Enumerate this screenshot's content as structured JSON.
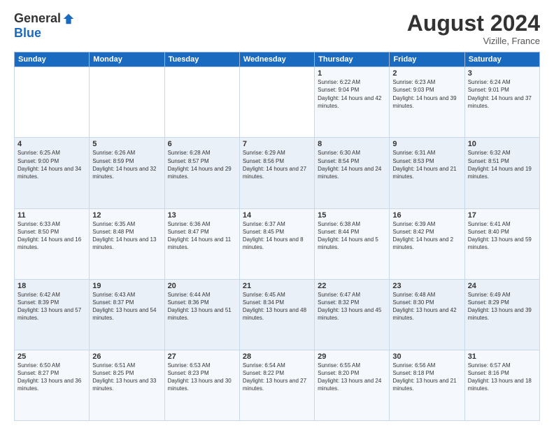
{
  "header": {
    "logo_general": "General",
    "logo_blue": "Blue",
    "month_title": "August 2024",
    "location": "Vizille, France"
  },
  "days_of_week": [
    "Sunday",
    "Monday",
    "Tuesday",
    "Wednesday",
    "Thursday",
    "Friday",
    "Saturday"
  ],
  "weeks": [
    [
      {
        "day": "",
        "sunrise": "",
        "sunset": "",
        "daylight": ""
      },
      {
        "day": "",
        "sunrise": "",
        "sunset": "",
        "daylight": ""
      },
      {
        "day": "",
        "sunrise": "",
        "sunset": "",
        "daylight": ""
      },
      {
        "day": "",
        "sunrise": "",
        "sunset": "",
        "daylight": ""
      },
      {
        "day": "1",
        "sunrise": "Sunrise: 6:22 AM",
        "sunset": "Sunset: 9:04 PM",
        "daylight": "Daylight: 14 hours and 42 minutes."
      },
      {
        "day": "2",
        "sunrise": "Sunrise: 6:23 AM",
        "sunset": "Sunset: 9:03 PM",
        "daylight": "Daylight: 14 hours and 39 minutes."
      },
      {
        "day": "3",
        "sunrise": "Sunrise: 6:24 AM",
        "sunset": "Sunset: 9:01 PM",
        "daylight": "Daylight: 14 hours and 37 minutes."
      }
    ],
    [
      {
        "day": "4",
        "sunrise": "Sunrise: 6:25 AM",
        "sunset": "Sunset: 9:00 PM",
        "daylight": "Daylight: 14 hours and 34 minutes."
      },
      {
        "day": "5",
        "sunrise": "Sunrise: 6:26 AM",
        "sunset": "Sunset: 8:59 PM",
        "daylight": "Daylight: 14 hours and 32 minutes."
      },
      {
        "day": "6",
        "sunrise": "Sunrise: 6:28 AM",
        "sunset": "Sunset: 8:57 PM",
        "daylight": "Daylight: 14 hours and 29 minutes."
      },
      {
        "day": "7",
        "sunrise": "Sunrise: 6:29 AM",
        "sunset": "Sunset: 8:56 PM",
        "daylight": "Daylight: 14 hours and 27 minutes."
      },
      {
        "day": "8",
        "sunrise": "Sunrise: 6:30 AM",
        "sunset": "Sunset: 8:54 PM",
        "daylight": "Daylight: 14 hours and 24 minutes."
      },
      {
        "day": "9",
        "sunrise": "Sunrise: 6:31 AM",
        "sunset": "Sunset: 8:53 PM",
        "daylight": "Daylight: 14 hours and 21 minutes."
      },
      {
        "day": "10",
        "sunrise": "Sunrise: 6:32 AM",
        "sunset": "Sunset: 8:51 PM",
        "daylight": "Daylight: 14 hours and 19 minutes."
      }
    ],
    [
      {
        "day": "11",
        "sunrise": "Sunrise: 6:33 AM",
        "sunset": "Sunset: 8:50 PM",
        "daylight": "Daylight: 14 hours and 16 minutes."
      },
      {
        "day": "12",
        "sunrise": "Sunrise: 6:35 AM",
        "sunset": "Sunset: 8:48 PM",
        "daylight": "Daylight: 14 hours and 13 minutes."
      },
      {
        "day": "13",
        "sunrise": "Sunrise: 6:36 AM",
        "sunset": "Sunset: 8:47 PM",
        "daylight": "Daylight: 14 hours and 11 minutes."
      },
      {
        "day": "14",
        "sunrise": "Sunrise: 6:37 AM",
        "sunset": "Sunset: 8:45 PM",
        "daylight": "Daylight: 14 hours and 8 minutes."
      },
      {
        "day": "15",
        "sunrise": "Sunrise: 6:38 AM",
        "sunset": "Sunset: 8:44 PM",
        "daylight": "Daylight: 14 hours and 5 minutes."
      },
      {
        "day": "16",
        "sunrise": "Sunrise: 6:39 AM",
        "sunset": "Sunset: 8:42 PM",
        "daylight": "Daylight: 14 hours and 2 minutes."
      },
      {
        "day": "17",
        "sunrise": "Sunrise: 6:41 AM",
        "sunset": "Sunset: 8:40 PM",
        "daylight": "Daylight: 13 hours and 59 minutes."
      }
    ],
    [
      {
        "day": "18",
        "sunrise": "Sunrise: 6:42 AM",
        "sunset": "Sunset: 8:39 PM",
        "daylight": "Daylight: 13 hours and 57 minutes."
      },
      {
        "day": "19",
        "sunrise": "Sunrise: 6:43 AM",
        "sunset": "Sunset: 8:37 PM",
        "daylight": "Daylight: 13 hours and 54 minutes."
      },
      {
        "day": "20",
        "sunrise": "Sunrise: 6:44 AM",
        "sunset": "Sunset: 8:36 PM",
        "daylight": "Daylight: 13 hours and 51 minutes."
      },
      {
        "day": "21",
        "sunrise": "Sunrise: 6:45 AM",
        "sunset": "Sunset: 8:34 PM",
        "daylight": "Daylight: 13 hours and 48 minutes."
      },
      {
        "day": "22",
        "sunrise": "Sunrise: 6:47 AM",
        "sunset": "Sunset: 8:32 PM",
        "daylight": "Daylight: 13 hours and 45 minutes."
      },
      {
        "day": "23",
        "sunrise": "Sunrise: 6:48 AM",
        "sunset": "Sunset: 8:30 PM",
        "daylight": "Daylight: 13 hours and 42 minutes."
      },
      {
        "day": "24",
        "sunrise": "Sunrise: 6:49 AM",
        "sunset": "Sunset: 8:29 PM",
        "daylight": "Daylight: 13 hours and 39 minutes."
      }
    ],
    [
      {
        "day": "25",
        "sunrise": "Sunrise: 6:50 AM",
        "sunset": "Sunset: 8:27 PM",
        "daylight": "Daylight: 13 hours and 36 minutes."
      },
      {
        "day": "26",
        "sunrise": "Sunrise: 6:51 AM",
        "sunset": "Sunset: 8:25 PM",
        "daylight": "Daylight: 13 hours and 33 minutes."
      },
      {
        "day": "27",
        "sunrise": "Sunrise: 6:53 AM",
        "sunset": "Sunset: 8:23 PM",
        "daylight": "Daylight: 13 hours and 30 minutes."
      },
      {
        "day": "28",
        "sunrise": "Sunrise: 6:54 AM",
        "sunset": "Sunset: 8:22 PM",
        "daylight": "Daylight: 13 hours and 27 minutes."
      },
      {
        "day": "29",
        "sunrise": "Sunrise: 6:55 AM",
        "sunset": "Sunset: 8:20 PM",
        "daylight": "Daylight: 13 hours and 24 minutes."
      },
      {
        "day": "30",
        "sunrise": "Sunrise: 6:56 AM",
        "sunset": "Sunset: 8:18 PM",
        "daylight": "Daylight: 13 hours and 21 minutes."
      },
      {
        "day": "31",
        "sunrise": "Sunrise: 6:57 AM",
        "sunset": "Sunset: 8:16 PM",
        "daylight": "Daylight: 13 hours and 18 minutes."
      }
    ]
  ]
}
